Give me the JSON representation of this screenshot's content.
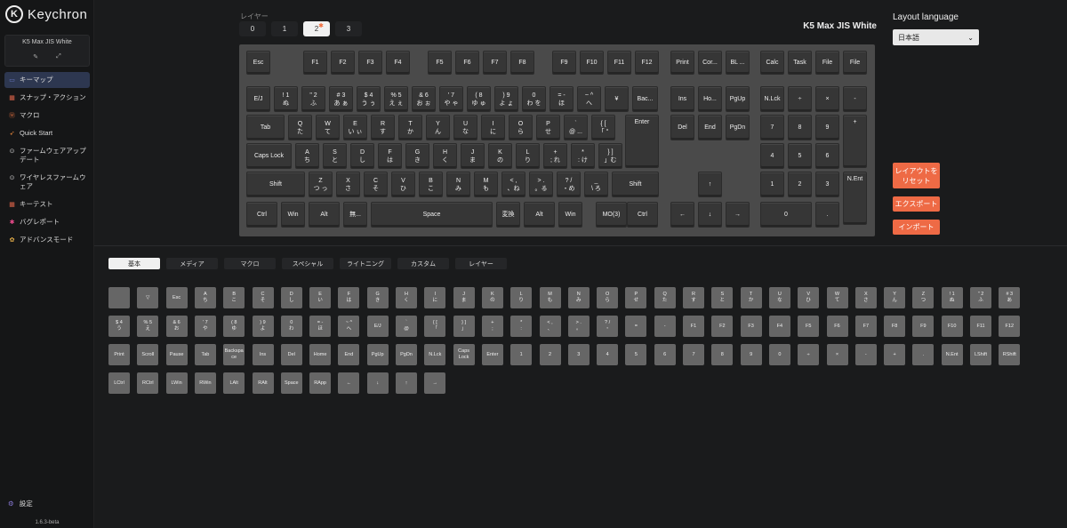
{
  "app": {
    "brand": "Keychron",
    "brand_letter": "K",
    "version": "1.6.3-beta"
  },
  "device": {
    "name": "K5 Max JIS White",
    "edit_icon": "pencil-icon",
    "unlink_icon": "unlink-icon"
  },
  "nav": [
    {
      "label": "キーマップ",
      "icon": "keyboard-icon",
      "color": "#6b78c8",
      "active": true
    },
    {
      "label": "スナップ・アクション",
      "icon": "calendar-icon",
      "color": "#e0654a"
    },
    {
      "label": "マクロ",
      "icon": "macro-icon",
      "color": "#d46a3d"
    },
    {
      "label": "Quick Start",
      "icon": "rocket-icon",
      "color": "#f08a3c"
    },
    {
      "label": "ファームウェアアップデート",
      "icon": "update-icon",
      "color": "#cccccc"
    },
    {
      "label": "ワイヤレスファームウェア",
      "icon": "wireless-icon",
      "color": "#cccccc"
    },
    {
      "label": "キーテスト",
      "icon": "test-icon",
      "color": "#e0654a"
    },
    {
      "label": "バグレポート",
      "icon": "bug-icon",
      "color": "#e84a8a"
    },
    {
      "label": "アドバンスモード",
      "icon": "palette-icon",
      "color": "#e8b04a"
    }
  ],
  "settings_label": "設定",
  "layers": {
    "label": "レイヤー",
    "tabs": [
      "0",
      "1",
      "2",
      "3"
    ],
    "active_index": 2
  },
  "keyboard_title": "K5 Max JIS White",
  "layout_language": {
    "label": "Layout language",
    "value": "日本語"
  },
  "actions": {
    "reset": "レイアウトを\nリセット",
    "export": "エクスポート",
    "import": "インポート"
  },
  "keyboard_rows": [
    [
      "Esc",
      "F1",
      "F2",
      "F3",
      "F4",
      "F5",
      "F6",
      "F7",
      "F8",
      "F9",
      "F10",
      "F11",
      "F12",
      "Print",
      "Cor...",
      "BL ...",
      "Calc",
      "Task",
      "File",
      "File"
    ],
    [
      "E/J",
      "! 1\nぬ",
      "\" 2\nふ",
      "# 3\nあ ぁ",
      "$ 4\nう ぅ",
      "% 5\nえ ぇ",
      "& 6\nお ぉ",
      "' 7\nや ゃ",
      "( 8\nゆ ゅ",
      ") 9\nよ ょ",
      "0\nわ を",
      "= -\nほ",
      "~ ^\nへ",
      "¥",
      "Bac...",
      "Ins",
      "Ho...",
      "PgUp",
      "N.Lck",
      "÷",
      "×",
      "-"
    ],
    [
      "Tab",
      "Q\nた",
      "W\nて",
      "E\nい ぃ",
      "R\nす",
      "T\nか",
      "Y\nん",
      "U\nな",
      "I\nに",
      "O\nら",
      "P\nせ",
      "` \n@ ...",
      "{ [\n「 °",
      "Enter",
      "Del",
      "End",
      "PgDn",
      "7",
      "8",
      "9",
      "+"
    ],
    [
      "Caps Lock",
      "A\nち",
      "S\nと",
      "D\nし",
      "F\nは",
      "G\nき",
      "H\nく",
      "J\nま",
      "K\nの",
      "L\nり",
      "+\n; れ",
      "*\n: け",
      "} ]\n」む"
    ],
    [
      "Shift",
      "Z\nつ っ",
      "X\nさ",
      "C\nそ",
      "V\nひ",
      "B\nこ",
      "N\nみ",
      "M\nも",
      "< ,\n、ね",
      "> .\n。る",
      "? /\n・め",
      "_\n\\ ろ",
      "Shift",
      "↑",
      "4",
      "5",
      "6",
      "1",
      "2",
      "3",
      "N.Ent"
    ],
    [
      "Ctrl",
      "Win",
      "Alt",
      "無...",
      "Space",
      "変換",
      "Alt",
      "Win",
      "MO(3)",
      "Ctrl",
      "←",
      "↓",
      "→",
      "0",
      "."
    ]
  ],
  "categories": {
    "tabs": [
      "基本",
      "メディア",
      "マクロ",
      "スペシャル",
      "ライトニング",
      "カスタム",
      "レイヤー"
    ],
    "active_index": 0
  },
  "palette_rows": [
    [
      "",
      "▽",
      "Esc",
      "A\nち",
      "B\nこ",
      "C\nそ",
      "D\nし",
      "E\nい",
      "F\nは",
      "G\nき",
      "H\nく",
      "I\nに",
      "J\nま",
      "K\nの",
      "L\nり",
      "M\nも",
      "N\nみ",
      "O\nら",
      "P\nせ",
      "Q\nた",
      "R\nす",
      "S\nと",
      "T\nか",
      "U\nな",
      "V\nひ",
      "W\nて",
      "X\nさ",
      "Y\nん",
      "Z\nつ",
      "! 1\nぬ",
      "\" 2\nふ",
      "# 3\nあ"
    ],
    [
      "$ 4\nう",
      "% 5\nえ",
      "& 6\nお",
      "' 7\nや",
      "( 8\nゆ",
      ") 9\nよ",
      "0\nわ",
      "= -\nほ",
      "~ ^\nへ",
      "E/J",
      "` \n@",
      "{ [\n「",
      "} ]\n」",
      "+\n;",
      "*\n:",
      "< ,\n、",
      "> .\n。",
      "? /\n・",
      "=",
      "-",
      "F1",
      "F2",
      "F3",
      "F4",
      "F5",
      "F6",
      "F7",
      "F8",
      "F9",
      "F10",
      "F11",
      "F12"
    ],
    [
      "Print",
      "Scroll",
      "Pause",
      "Tab",
      "Backspa\nce",
      "Ins",
      "Del",
      "Home",
      "End",
      "PgUp",
      "PgDn",
      "N.Lck",
      "Caps\nLock",
      "Enter",
      "1",
      "2",
      "3",
      "4",
      "5",
      "6",
      "7",
      "8",
      "9",
      "0",
      "÷",
      "×",
      "-",
      "+",
      ".",
      "N.Ent",
      "LShift",
      "RShift"
    ],
    [
      "LCtrl",
      "RCtrl",
      "LWin",
      "RWin",
      "LAlt",
      "RAlt",
      "Space",
      "RApp",
      "←",
      "↓",
      "↑",
      "→"
    ]
  ]
}
